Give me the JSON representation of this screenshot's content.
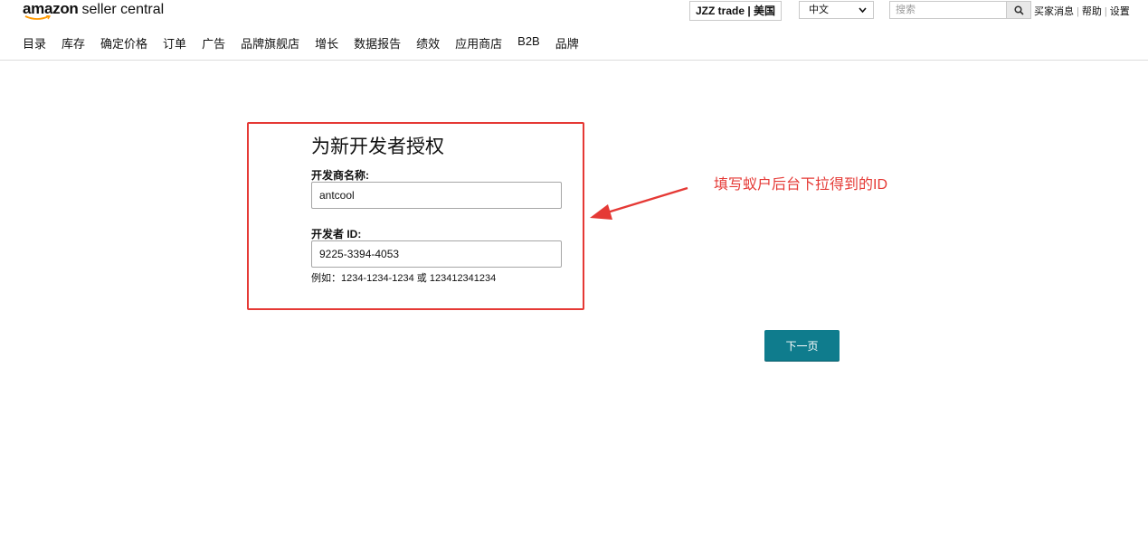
{
  "header": {
    "logo_brand": "amazon",
    "logo_suffix": "seller central",
    "store_selector": "JZZ trade | 美国",
    "language_select": "中文",
    "search_placeholder": "搜索",
    "links": [
      "买家消息",
      "帮助",
      "设置"
    ]
  },
  "nav": {
    "items": [
      "目录",
      "库存",
      "确定价格",
      "订单",
      "广告",
      "品牌旗舰店",
      "增长",
      "数据报告",
      "绩效",
      "应用商店",
      "B2B",
      "品牌"
    ]
  },
  "form": {
    "title": "为新开发者授权",
    "developer_name_label": "开发商名称:",
    "developer_name_value": "antcool",
    "developer_id_label": "开发者 ID:",
    "developer_id_value": "9225-3394-4053",
    "hint": "例如：1234-1234-1234 或 123412341234"
  },
  "annotation": {
    "text": "填写蚁户后台下拉得到的ID",
    "color": "#e53935"
  },
  "next_button": {
    "label": "下一页",
    "color": "#0f7c8d"
  }
}
